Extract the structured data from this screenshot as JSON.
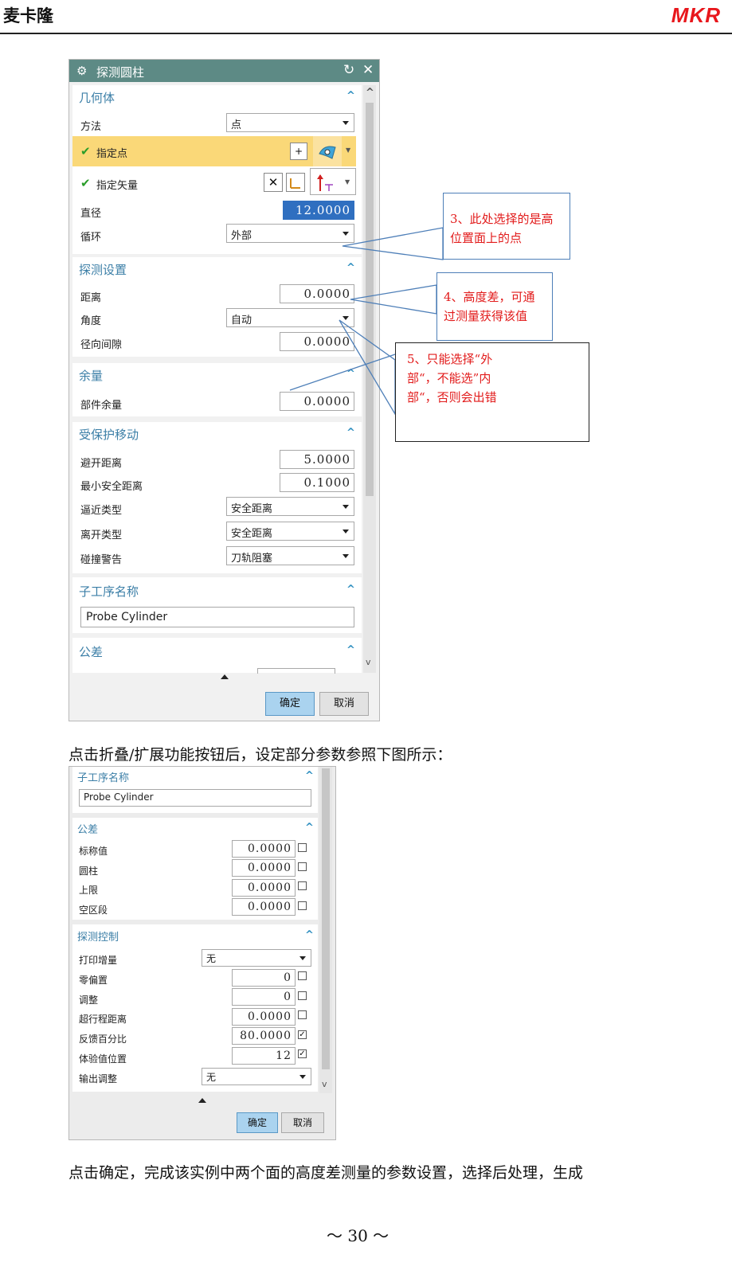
{
  "header": {
    "title": "麦卡隆",
    "logo": "MKR"
  },
  "dialog1": {
    "title": "探测圆柱",
    "geometry": {
      "heading": "几何体",
      "method_label": "方法",
      "method_value": "点",
      "specify_point_label": "指定点",
      "specify_vector_label": "指定矢量",
      "diameter_label": "直径",
      "diameter_value": "12.0000",
      "loop_label": "循环",
      "loop_value": "外部"
    },
    "probe_settings": {
      "heading": "探测设置",
      "distance_label": "距离",
      "distance_value": "0.0000",
      "angle_label": "角度",
      "angle_value": "自动",
      "radial_gap_label": "径向间隙",
      "radial_gap_value": "0.0000"
    },
    "stock": {
      "heading": "余量",
      "part_stock_label": "部件余量",
      "part_stock_value": "0.0000"
    },
    "protected_move": {
      "heading": "受保护移动",
      "clearance_label": "避开距离",
      "clearance_value": "5.0000",
      "min_safe_label": "最小安全距离",
      "min_safe_value": "0.1000",
      "approach_label": "逼近类型",
      "approach_value": "安全距离",
      "depart_label": "离开类型",
      "depart_value": "安全距离",
      "collision_label": "碰撞警告",
      "collision_value": "刀轨阻塞"
    },
    "sub_op": {
      "heading": "子工序名称",
      "value": "Probe Cylinder"
    },
    "tolerance": {
      "heading": "公差"
    },
    "ok": "确定",
    "cancel": "取消"
  },
  "callouts": {
    "c3": "3、此处选择的是高位置面上的点",
    "c4": "4、高度差，可通过测量获得该值",
    "c5": "5、只能选择“外部“，不能选”内部“，否则会出错"
  },
  "paragraph1": "点击折叠/扩展功能按钮后，设定部分参数参照下图所示：",
  "dialog2": {
    "sub_op": {
      "heading": "子工序名称",
      "value": "Probe Cylinder"
    },
    "tolerance": {
      "heading": "公差",
      "rows": [
        {
          "label": "标称值",
          "value": "0.0000"
        },
        {
          "label": "圆柱",
          "value": "0.0000"
        },
        {
          "label": "上限",
          "value": "0.0000"
        },
        {
          "label": "空区段",
          "value": "0.0000"
        }
      ]
    },
    "probe_control": {
      "heading": "探测控制",
      "print_inc_label": "打印增量",
      "print_inc_value": "无",
      "rows": [
        {
          "label": "零偏置",
          "value": "0",
          "checked": false
        },
        {
          "label": "调整",
          "value": "0",
          "checked": false
        },
        {
          "label": "超行程距离",
          "value": "0.0000",
          "checked": false
        },
        {
          "label": "反馈百分比",
          "value": "80.0000",
          "checked": true
        },
        {
          "label": "体验值位置",
          "value": "12",
          "checked": true
        }
      ],
      "output_adj_label": "输出调整",
      "output_adj_value": "无"
    },
    "ok": "确定",
    "cancel": "取消"
  },
  "paragraph2": "点击确定，完成该实例中两个面的高度差测量的参数设置，选择后处理，生成",
  "page_number": "～ 30 ～"
}
